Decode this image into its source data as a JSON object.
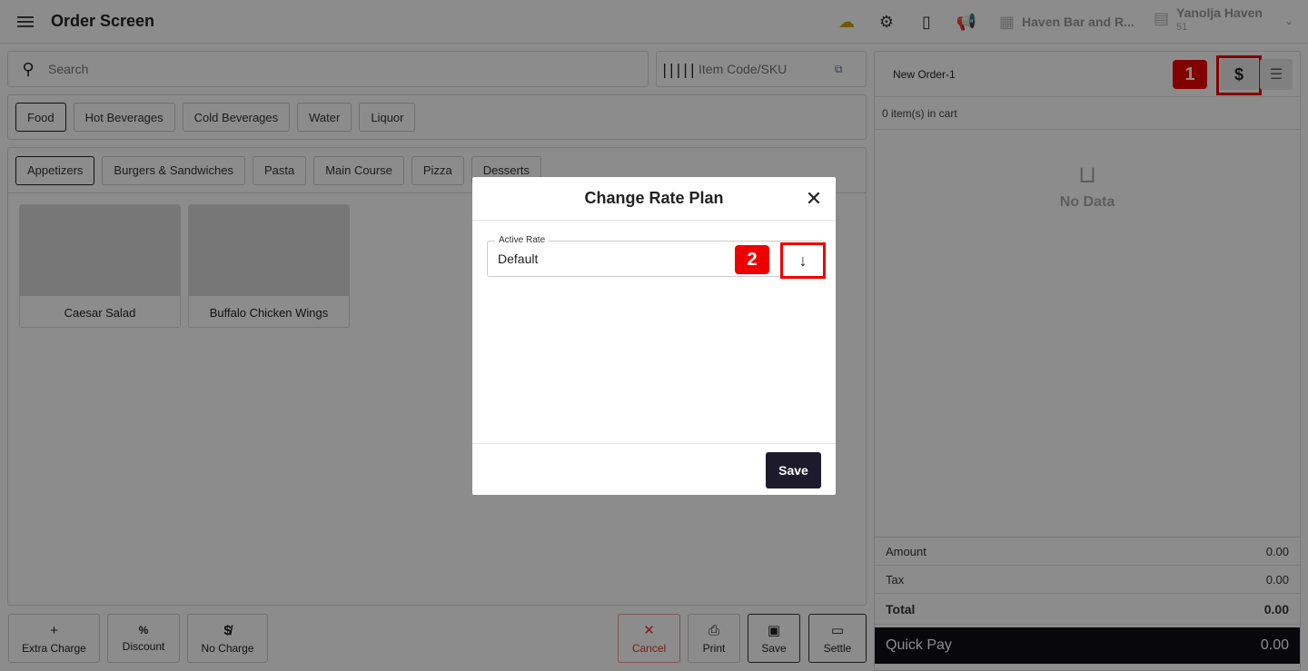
{
  "header": {
    "title": "Order Screen",
    "icons": [
      "cloud-off-icon",
      "gear-icon",
      "tablet-icon",
      "megaphone-icon"
    ],
    "store_name": "Haven Bar and R...",
    "user_name": "Yanolja Haven",
    "user_sub": "51"
  },
  "search": {
    "placeholder": "Search"
  },
  "sku": {
    "placeholder": "Item Code/SKU"
  },
  "categories": [
    "Food",
    "Hot Beverages",
    "Cold Beverages",
    "Water",
    "Liquor"
  ],
  "subcategories": [
    "Appetizers",
    "Burgers & Sandwiches",
    "Pasta",
    "Main Course",
    "Pizza",
    "Desserts"
  ],
  "items": [
    "Caesar Salad",
    "Buffalo Chicken Wings"
  ],
  "bottom_actions": {
    "extra_charge": "Extra Charge",
    "discount": "Discount",
    "no_charge": "No Charge",
    "cancel": "Cancel",
    "print": "Print",
    "save": "Save",
    "settle": "Settle"
  },
  "cart": {
    "order_name": "New Order-1",
    "item_count": "0 item(s) in cart",
    "empty_text": "No Data",
    "amount_label": "Amount",
    "amount_value": "0.00",
    "tax_label": "Tax",
    "tax_value": "0.00",
    "total_label": "Total",
    "total_value": "0.00",
    "quickpay_label": "Quick Pay",
    "quickpay_value": "0.00"
  },
  "annotations": {
    "step1": "1",
    "step2": "2"
  },
  "modal": {
    "title": "Change Rate Plan",
    "field_label": "Active Rate",
    "field_value": "Default",
    "save_label": "Save"
  },
  "colors": {
    "highlight": "#e00000",
    "dark_button": "#1c1a2b",
    "quickpay_bg": "#0d0d17"
  }
}
